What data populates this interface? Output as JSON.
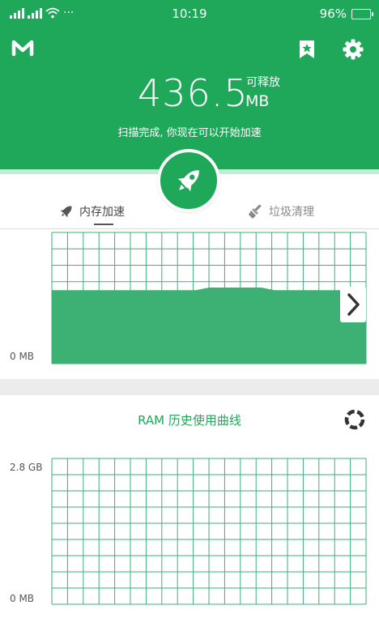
{
  "status": {
    "signal": "ıIl ıIl",
    "more": "···",
    "time": "10:19",
    "battery": "96%",
    "battery_level": 0.96
  },
  "header": {
    "freeable_value": "436.5",
    "freeable_label": "可释放",
    "unit": "MB",
    "scan_message": "扫描完成, 你现在可以开始加速"
  },
  "icons": {
    "logo": "m-logo-icon",
    "bookmark": "bookmark-star-icon",
    "settings": "gear-icon",
    "boost": "rocket-icon",
    "ram_tab": "rocket-small-icon",
    "junk_tab": "broom-icon",
    "next": "chevron-right-icon",
    "refresh": "refresh-ring-icon"
  },
  "tabs": [
    {
      "label": "内存加速",
      "active": true
    },
    {
      "label": "垃圾清理",
      "active": false
    }
  ],
  "realtime_chart": {
    "y_min_label": "0 MB"
  },
  "history_chart": {
    "title": "RAM 历史使用曲线",
    "y_max_label": "2.8 GB",
    "y_min_label": "0 MB"
  },
  "colors": {
    "primary": "#1fa75a",
    "chart_fill": "#3db074",
    "grid_line": "#3cb07a"
  },
  "chart_data": [
    {
      "type": "area",
      "series": [
        {
          "values": [
            0.56,
            0.56,
            0.56,
            0.56,
            0.56,
            0.56,
            0.56,
            0.56,
            0.56,
            0.56,
            0.56,
            0.56,
            0.58,
            0.58,
            0.58,
            0.58,
            0.58,
            0.56,
            0.56,
            0.56,
            0.56,
            0.56,
            0.56,
            0.56,
            0.56
          ]
        }
      ],
      "ylabel_min": "0 MB",
      "grid": true
    },
    {
      "type": "line",
      "series": [],
      "title": "RAM 历史使用曲线",
      "ylim_labels": [
        "0 MB",
        "2.8 GB"
      ],
      "grid": true
    }
  ]
}
